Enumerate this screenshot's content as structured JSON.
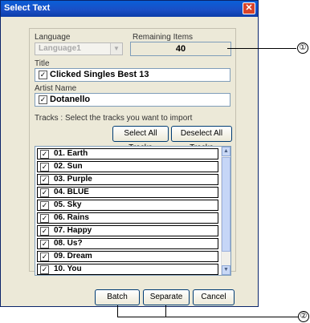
{
  "window": {
    "title": "Select Text",
    "close_symbol": "✕"
  },
  "language": {
    "label": "Language",
    "value": "Language1"
  },
  "remaining": {
    "label": "Remaining Items",
    "value": "40"
  },
  "title_field": {
    "label": "Title",
    "value": "Clicked Singles Best 13"
  },
  "artist_field": {
    "label": "Artist Name",
    "value": "Dotanello"
  },
  "tracks": {
    "instruction": "Tracks  : Select the tracks you want to import",
    "select_all_label": "Select All Tracks",
    "deselect_all_label": "Deselect All Tracks",
    "items": [
      {
        "name": "01. Earth",
        "checked": true
      },
      {
        "name": "02. Sun",
        "checked": true
      },
      {
        "name": "03. Purple",
        "checked": true
      },
      {
        "name": "04. BLUE",
        "checked": true
      },
      {
        "name": "05. Sky",
        "checked": true
      },
      {
        "name": "06. Rains",
        "checked": true
      },
      {
        "name": "07. Happy",
        "checked": true
      },
      {
        "name": "08. Us?",
        "checked": true
      },
      {
        "name": "09. Dream",
        "checked": true
      },
      {
        "name": "10. You",
        "checked": true
      }
    ]
  },
  "buttons": {
    "batch": "Batch",
    "separate": "Separate",
    "cancel": "Cancel"
  },
  "callouts": {
    "one": "①",
    "two": "②"
  },
  "check_mark": "✓"
}
